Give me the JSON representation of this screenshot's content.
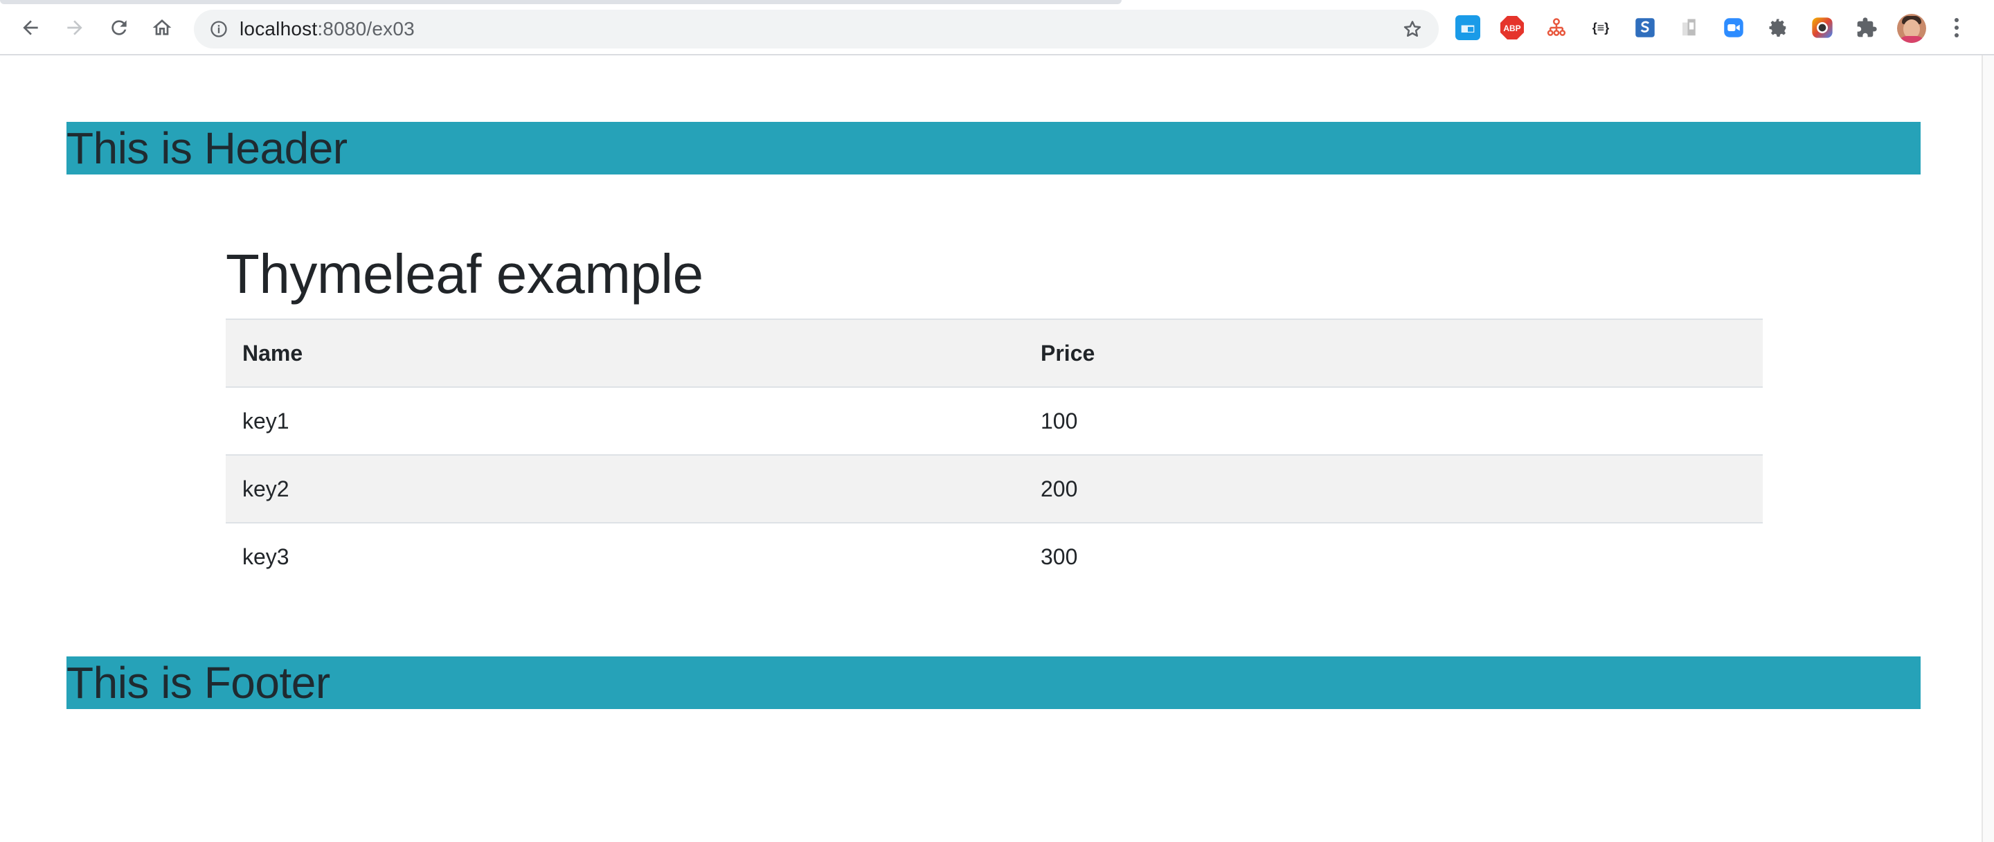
{
  "browser": {
    "url_host": "localhost",
    "url_path": ":8080/ex03",
    "nav_icons": [
      "back-arrow-icon",
      "forward-arrow-icon",
      "reload-icon",
      "home-icon"
    ],
    "extensions": [
      {
        "name": "extension-blue-window-icon",
        "color": "#1a9be8",
        "label": ""
      },
      {
        "name": "adblock-plus-icon",
        "color": "#e5342b",
        "label": "ABP"
      },
      {
        "name": "sitemap-icon",
        "color": "#e8573d",
        "label": ""
      },
      {
        "name": "json-viewer-icon",
        "color": "#202124",
        "label": "{≡}"
      },
      {
        "name": "s-extension-icon",
        "color": "#2f6ebd",
        "label": "S"
      },
      {
        "name": "grey-bookmark-icon",
        "color": "#bdbdbd",
        "label": ""
      },
      {
        "name": "zoom-icon",
        "color": "#2d8cff",
        "label": ""
      },
      {
        "name": "gear-extension-icon",
        "color": "#5f6368",
        "label": ""
      },
      {
        "name": "color-picker-icon",
        "color": "#7b3fb6",
        "label": ""
      },
      {
        "name": "puzzle-extensions-icon",
        "color": "#5f6368",
        "label": ""
      }
    ]
  },
  "page": {
    "header_text": "This is Header",
    "title": "Thymeleaf example",
    "table": {
      "headers": [
        "Name",
        "Price"
      ],
      "rows": [
        [
          "key1",
          "100"
        ],
        [
          "key2",
          "200"
        ],
        [
          "key3",
          "300"
        ]
      ]
    },
    "footer_text": "This is Footer"
  },
  "colors": {
    "band": "#26a2b8",
    "row_shade": "#f2f2f2",
    "text": "#212529"
  }
}
